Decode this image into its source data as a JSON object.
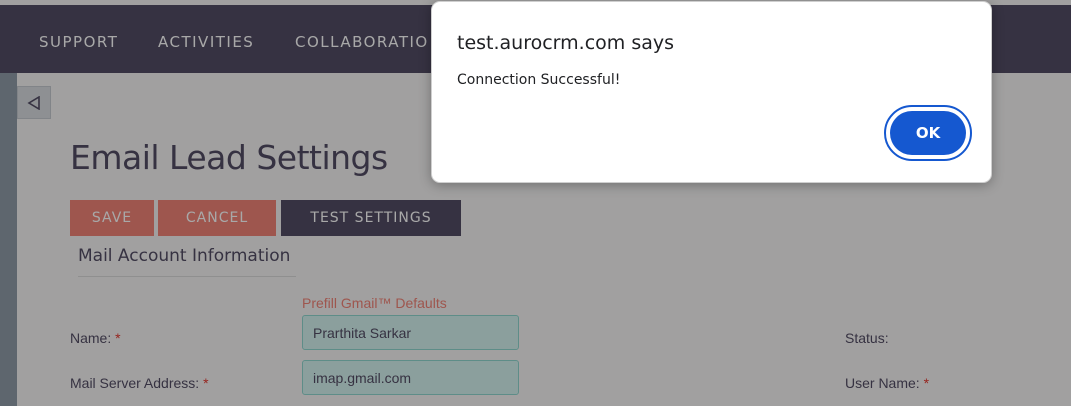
{
  "nav": {
    "items": [
      "SUPPORT",
      "ACTIVITIES",
      "COLLABORATIO"
    ]
  },
  "page": {
    "title": "Email Lead Settings",
    "buttons": {
      "save": "SAVE",
      "cancel": "CANCEL",
      "test": "TEST SETTINGS"
    },
    "section_title": "Mail Account Information",
    "prefill_link": "Prefill Gmail™ Defaults",
    "fields": {
      "name_label": "Name:",
      "name_value": "Prarthita Sarkar",
      "server_label": "Mail Server Address:",
      "server_value": "imap.gmail.com",
      "status_label": "Status:",
      "username_label": "User Name:",
      "required_marker": "*"
    }
  },
  "dialog": {
    "title": "test.aurocrm.com says",
    "message": "Connection Successful!",
    "ok_label": "OK"
  },
  "colors": {
    "nav_bg": "#534d64",
    "accent": "#f08377",
    "dialog_button": "#1558d0"
  }
}
